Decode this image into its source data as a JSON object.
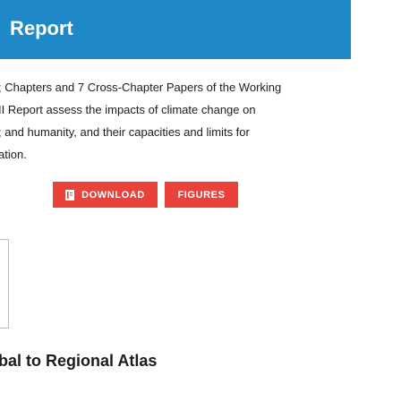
{
  "header": {
    "title": "Report"
  },
  "description": {
    "lines": [
      "; Chapters and 7 Cross-Chapter Papers of the Working",
      "II Report assess the impacts of climate change on",
      "; and humanity, and their capacities and limits for",
      "ation."
    ]
  },
  "actions": {
    "download_label": "DOWNLOAD",
    "figures_label": "FIGURES"
  },
  "footer": {
    "title": "bal to Regional Atlas"
  },
  "colors": {
    "header_bg": "#1f88c6",
    "button_bg": "#e8423a"
  },
  "icons": {
    "download": "document-icon"
  }
}
